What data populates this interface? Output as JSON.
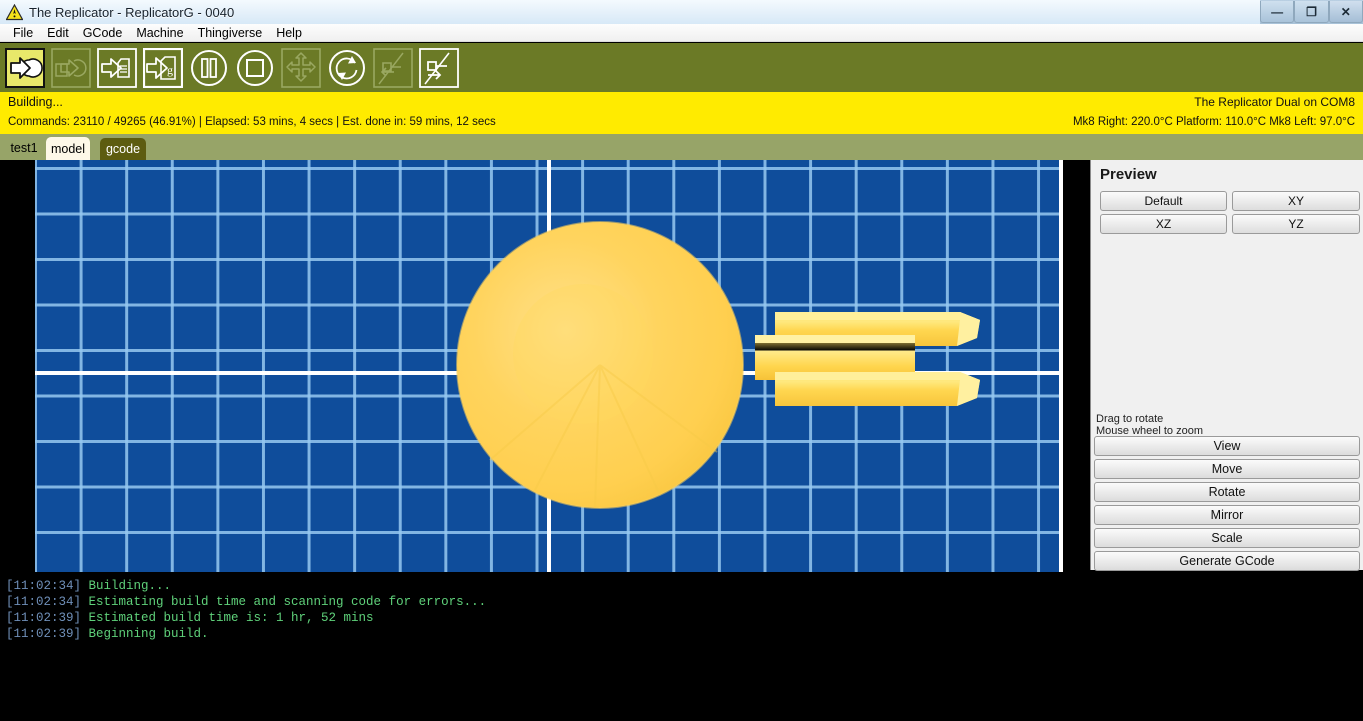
{
  "window": {
    "title": "The Replicator - ReplicatorG - 0040",
    "app_icon": "warning-triangle-icon",
    "minimize_label": "—",
    "maximize_label": "❐",
    "close_label": "✕"
  },
  "menubar": {
    "items": [
      {
        "label": "File"
      },
      {
        "label": "Edit"
      },
      {
        "label": "GCode"
      },
      {
        "label": "Machine"
      },
      {
        "label": "Thingiverse"
      },
      {
        "label": "Help"
      }
    ]
  },
  "toolbar": {
    "buttons": [
      {
        "name": "build-icon",
        "title": "Build",
        "state": "active"
      },
      {
        "name": "build-to-file-icon",
        "title": "Build to file",
        "state": "disabled"
      },
      {
        "name": "build-from-file-icon",
        "title": "Build from file",
        "state": "enabled"
      },
      {
        "name": "generate-gcode-icon",
        "title": "Generate GCode",
        "state": "enabled"
      },
      {
        "name": "pause-icon",
        "title": "Pause",
        "state": "enabled"
      },
      {
        "name": "stop-icon",
        "title": "Stop",
        "state": "enabled"
      },
      {
        "name": "control-panel-icon",
        "title": "Control panel",
        "state": "disabled"
      },
      {
        "name": "reset-icon",
        "title": "Reset machine",
        "state": "enabled"
      },
      {
        "name": "disconnect-icon",
        "title": "Disconnect",
        "state": "disabled"
      },
      {
        "name": "connect-icon",
        "title": "Connect",
        "state": "enabled"
      }
    ]
  },
  "status": {
    "build_state": "Building...",
    "machine": "The Replicator Dual on COM8",
    "commands": "Commands:   23110 /   49265  (46.91%) | Elapsed: 53 mins, 4 secs  |  Est. done in:  59 mins, 12 secs",
    "temps": "Mk8 Right: 220.0°C  Platform: 110.0°C Mk8 Left: 97.0°C",
    "banner_color": "#ffeb00",
    "commands_done": 23110,
    "commands_total": 49265,
    "percent": "46.91%",
    "elapsed": "53 mins, 4 secs",
    "est_done_in": "59 mins, 12 secs",
    "mk8_right_temp": "220.0°C",
    "platform_temp": "110.0°C",
    "mk8_left_temp": "97.0°C"
  },
  "tabs": [
    {
      "label": "test1",
      "state": "plain"
    },
    {
      "label": "model",
      "state": "active"
    },
    {
      "label": "gcode",
      "state": "inactive"
    }
  ],
  "viewport": {
    "background_color": "#0f4d9b",
    "grid_line_color": "#96c8f0",
    "axis_color": "#ffffff",
    "model_color": "#ffd24d",
    "model_highlight_color": "#ffe27a"
  },
  "preview": {
    "title": "Preview",
    "view_buttons": [
      {
        "label": "Default"
      },
      {
        "label": "XY"
      },
      {
        "label": "XZ"
      },
      {
        "label": "YZ"
      }
    ],
    "hint": "Drag to rotate\nMouse wheel to zoom",
    "action_buttons": [
      {
        "label": "View"
      },
      {
        "label": "Move"
      },
      {
        "label": "Rotate"
      },
      {
        "label": "Mirror"
      },
      {
        "label": "Scale"
      },
      {
        "label": "Generate GCode"
      }
    ]
  },
  "console": {
    "lines": [
      {
        "time": "[11:02:34]",
        "text": "Building..."
      },
      {
        "time": "[11:02:34]",
        "text": "Estimating build time and scanning code for errors..."
      },
      {
        "time": "[11:02:39]",
        "text": "Estimated build time is: 1 hr, 52 mins"
      },
      {
        "time": "[11:02:39]",
        "text": "Beginning build."
      }
    ]
  }
}
